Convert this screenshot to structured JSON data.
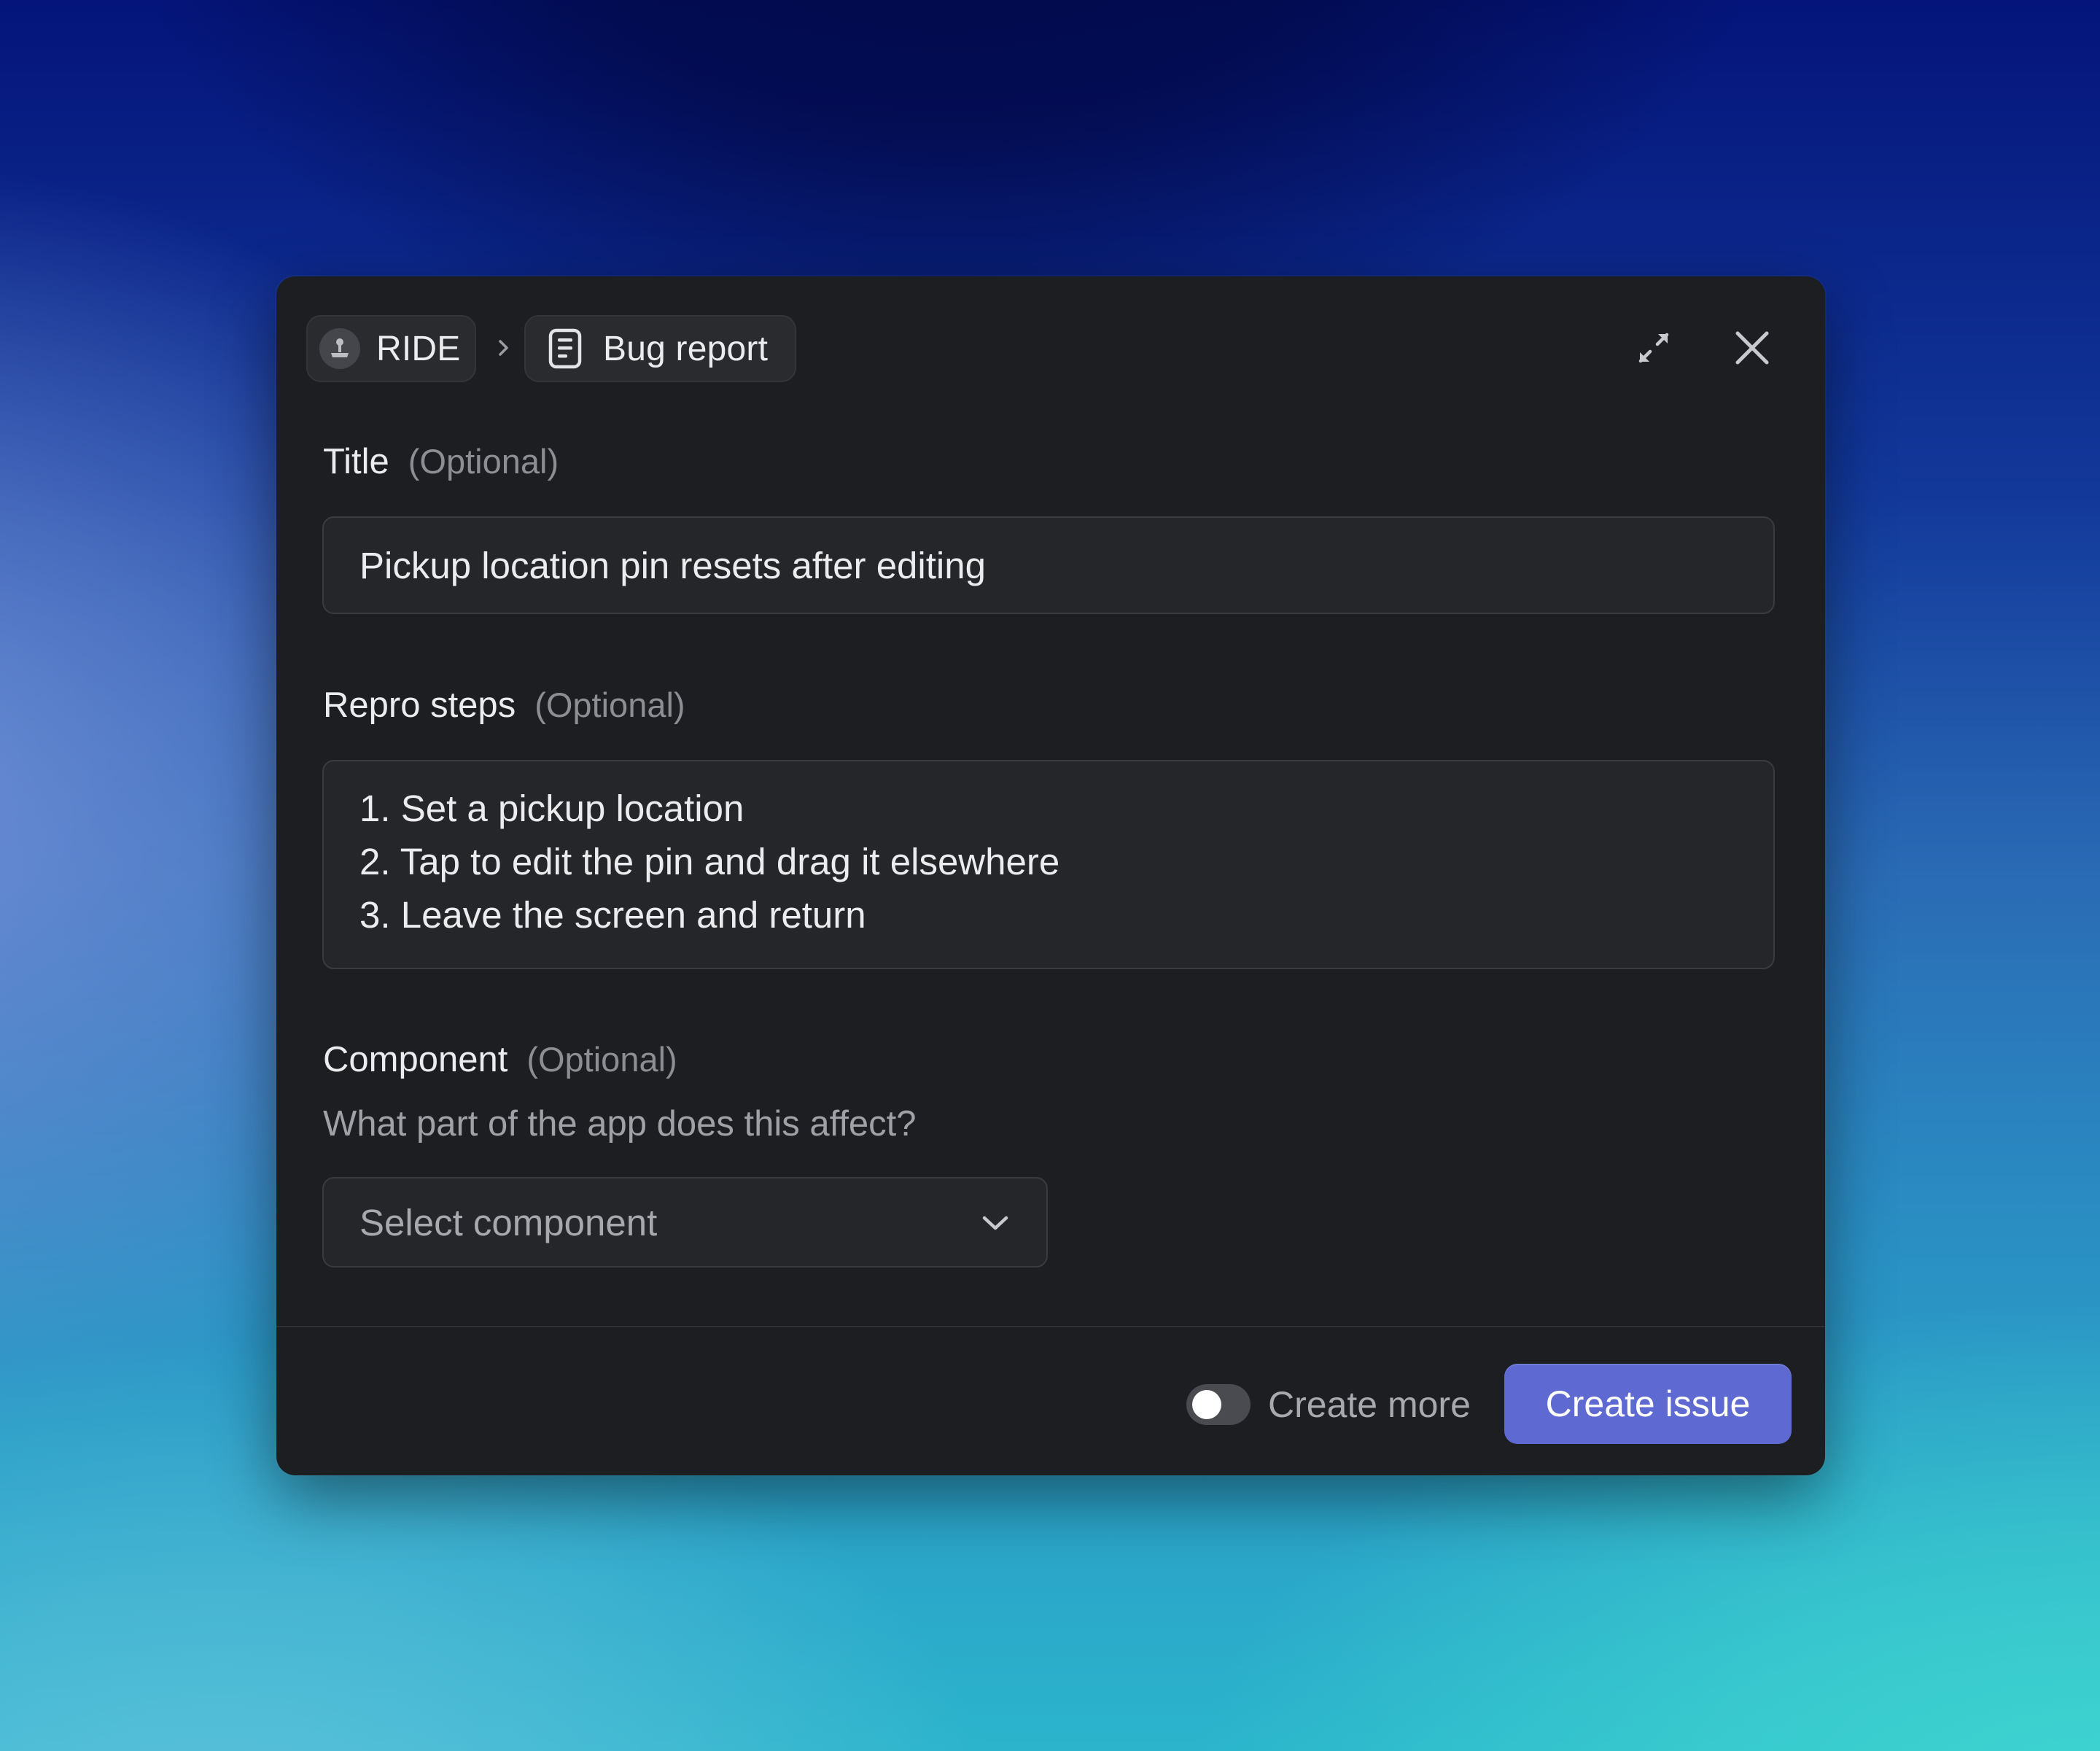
{
  "breadcrumb": {
    "team": "RIDE",
    "team_icon": "joystick-icon",
    "template": "Bug report",
    "template_icon": "document-icon",
    "separator_icon": "chevron-right-icon"
  },
  "header_actions": {
    "expand_icon": "expand-icon",
    "close_icon": "close-icon"
  },
  "form": {
    "title": {
      "label": "Title",
      "optional": "(Optional)",
      "value": "Pickup location pin resets after editing"
    },
    "repro_steps": {
      "label": "Repro steps",
      "optional": "(Optional)",
      "lines": [
        "1. Set a pickup location",
        "2. Tap to edit the pin and drag it elsewhere",
        "3. Leave the screen and return"
      ]
    },
    "component": {
      "label": "Component",
      "optional": "(Optional)",
      "helper": "What part of the app does this affect?",
      "placeholder": "Select component"
    }
  },
  "footer": {
    "create_more_label": "Create more",
    "create_more_on": false,
    "submit_label": "Create issue"
  },
  "colors": {
    "modal_bg": "#1d1e21",
    "field_bg": "#25262a",
    "accent": "#5e6ad2",
    "text_primary": "#ececee",
    "text_muted": "#8d8e94"
  }
}
